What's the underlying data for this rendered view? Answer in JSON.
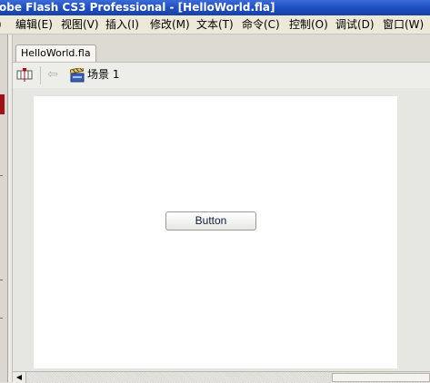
{
  "window": {
    "title": "obe Flash CS3 Professional - [HelloWorld.fla]"
  },
  "menu": [
    {
      "id": "edit",
      "label": "编辑(E)"
    },
    {
      "id": "view",
      "label": "视图(V)"
    },
    {
      "id": "insert",
      "label": "插入(I)"
    },
    {
      "id": "modify",
      "label": "修改(M)"
    },
    {
      "id": "text",
      "label": "文本(T)"
    },
    {
      "id": "command",
      "label": "命令(C)"
    },
    {
      "id": "control",
      "label": "控制(O)"
    },
    {
      "id": "debug",
      "label": "调试(D)"
    },
    {
      "id": "window",
      "label": "窗口(W)"
    }
  ],
  "menu_leading": ")",
  "document": {
    "tab_label": "HelloWorld.fla"
  },
  "edit_bar": {
    "scene_label": "场景 1"
  },
  "stage": {
    "button_label": "Button"
  },
  "colors": {
    "titlebar": "#1f4fc0",
    "menubar": "#ece9d8",
    "stage": "#ffffff",
    "accent_red": "#a01218"
  },
  "icons": [
    "timeline-icon",
    "back-arrow-icon",
    "scene-clapper-icon",
    "scroll-left-icon"
  ]
}
